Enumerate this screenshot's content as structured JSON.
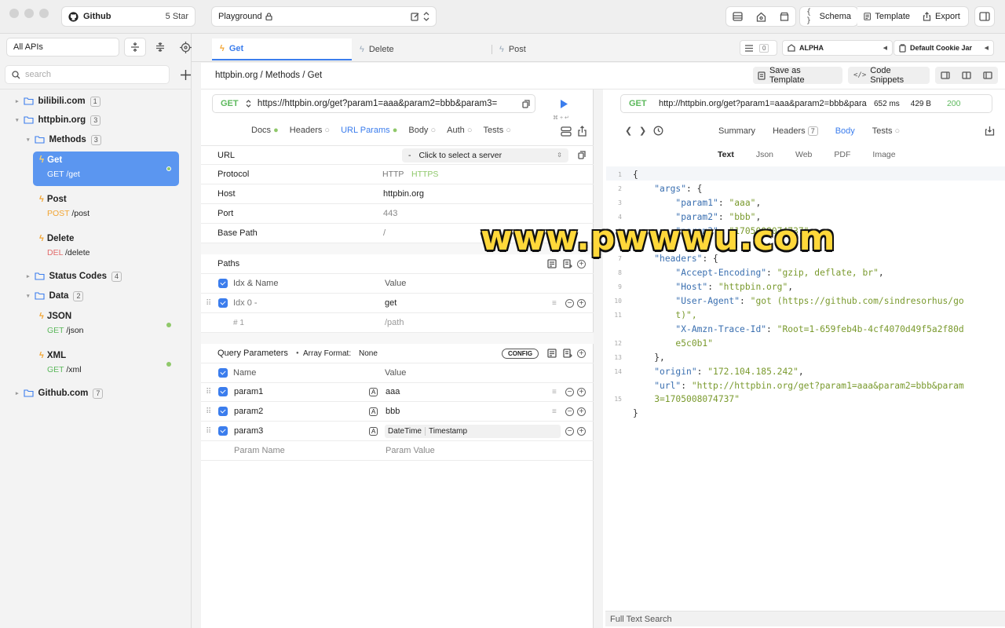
{
  "topbar": {
    "repo_name": "Github",
    "stars": "5 Star",
    "workspace": "Playground",
    "schema_label": "Schema",
    "template_label": "Template",
    "export_label": "Export"
  },
  "sidebar": {
    "filter": "All APIs",
    "search_placeholder": "search",
    "tree": [
      {
        "label": "bilibili.com",
        "count": "1"
      },
      {
        "label": "httpbin.org",
        "count": "3"
      },
      {
        "label": "Methods",
        "count": "3"
      },
      {
        "label": "Status Codes",
        "count": "4"
      },
      {
        "label": "Data",
        "count": "2"
      },
      {
        "label": "Github.com",
        "count": "7"
      }
    ],
    "requests": [
      {
        "name": "Get",
        "method": "GET",
        "path": "/get"
      },
      {
        "name": "Post",
        "method": "POST",
        "path": "/post"
      },
      {
        "name": "Delete",
        "method": "DEL",
        "path": "/delete"
      },
      {
        "name": "JSON",
        "method": "GET",
        "path": "/json"
      },
      {
        "name": "XML",
        "method": "GET",
        "path": "/xml"
      }
    ]
  },
  "tabs": [
    {
      "label": "Get"
    },
    {
      "label": "Delete"
    },
    {
      "label": "Post"
    }
  ],
  "tabbar_right": {
    "count": "0",
    "env": "ALPHA",
    "cookie_jar": "Default Cookie Jar"
  },
  "breadcrumb": "httpbin.org / Methods / Get",
  "actions": {
    "save_template": "Save as Template",
    "code_snippets": "Code Snippets"
  },
  "request": {
    "method": "GET",
    "url": "https://httpbin.org/get?param1=aaa&param2=bbb&param3=",
    "subtabs": [
      "Docs",
      "Headers",
      "URL Params",
      "Body",
      "Auth",
      "Tests"
    ],
    "active_subtab": "URL Params"
  },
  "url_section": {
    "url_label": "URL",
    "server_dash": "-",
    "server_placeholder": "Click to select a server",
    "protocol_label": "Protocol",
    "protocol_http": "HTTP",
    "protocol_https": "HTTPS",
    "host_label": "Host",
    "host_value": "httpbin.org",
    "port_label": "Port",
    "port_value": "443",
    "basepath_label": "Base Path",
    "basepath_value": "/"
  },
  "paths": {
    "title": "Paths",
    "col_name": "Idx & Name",
    "col_value": "Value",
    "row_name": "Idx 0  -",
    "row_value": "get",
    "empty_name": "# 1",
    "empty_value": "/path"
  },
  "query": {
    "title": "Query Parameters",
    "array_format_label": "Array Format:",
    "array_format_value": "None",
    "config": "CONFIG",
    "col_name": "Name",
    "col_value": "Value",
    "params": [
      {
        "name": "param1",
        "value": "aaa"
      },
      {
        "name": "param2",
        "value": "bbb"
      },
      {
        "name": "param3",
        "value": "DateTime",
        "value2": "Timestamp"
      }
    ],
    "placeholder_name": "Param Name",
    "placeholder_value": "Param Value"
  },
  "response": {
    "method": "GET",
    "url": "http://httpbin.org/get?param1=aaa&param2=bbb&para",
    "time": "652 ms",
    "size": "429 B",
    "status": "200",
    "tabs": [
      "Summary",
      "Headers",
      "Body",
      "Tests"
    ],
    "headers_count": "7",
    "active_tab": "Body",
    "formats": [
      "Text",
      "Json",
      "Web",
      "PDF",
      "Image"
    ],
    "active_format": "Text",
    "search_placeholder": "Full Text Search",
    "line_numbers": [
      "1",
      "2",
      "3",
      "4",
      "5",
      "6",
      "7",
      "8",
      "9",
      "10",
      "11",
      "",
      "12",
      "13",
      "14",
      "",
      "15"
    ],
    "code": [
      "{",
      "    \"args\": {",
      "        \"param1\": \"aaa\",",
      "        \"param2\": \"bbb\",",
      "        \"param3\": \"1705008074737\"",
      "    },",
      "    \"headers\": {",
      "        \"Accept-Encoding\": \"gzip, deflate, br\",",
      "        \"Host\": \"httpbin.org\",",
      "        \"User-Agent\": \"got (https://github.com/sindresorhus/go",
      "        t)\",",
      "        \"X-Amzn-Trace-Id\": \"Root=1-659feb4b-4cf4070d49f5a2f80d",
      "        e5c0b1\"",
      "    },",
      "    \"origin\": \"172.104.185.242\",",
      "    \"url\": \"http://httpbin.org/get?param1=aaa&param2=bbb&param",
      "    3=1705008074737\"",
      "}"
    ]
  },
  "watermark": "www.pwwwu.com",
  "colors": {
    "accent": "#3b7ded",
    "selected": "#5b96f0",
    "get": "#5cb85c",
    "post": "#f2a431",
    "del": "#e26b6b"
  }
}
